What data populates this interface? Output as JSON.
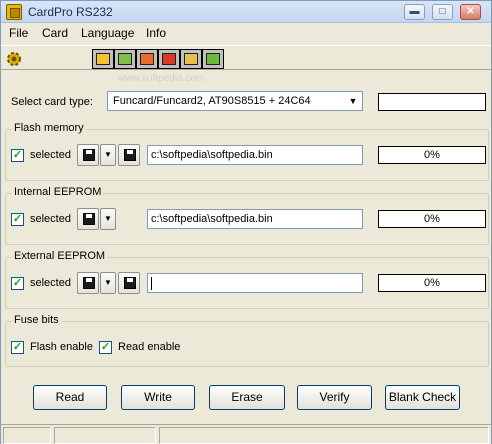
{
  "window": {
    "title": "CardPro RS232"
  },
  "title_buttons": {
    "minimize": "▬",
    "maximize": "□",
    "close": "✕"
  },
  "menu": [
    "File",
    "Card",
    "Language",
    "Info"
  ],
  "toolbar_icons": [
    "settings-icon",
    "card-read-icon",
    "card-write-icon",
    "card-erase-icon",
    "card-verify-icon",
    "card-blank-icon"
  ],
  "watermark": "www.softpedia.com",
  "card_type": {
    "label": "Select card type:",
    "value": "Funcard/Funcard2, AT90S8515 + 24C64",
    "progress": ""
  },
  "flash": {
    "title": "Flash memory",
    "selected_label": "selected",
    "checked": true,
    "path": "c:\\softpedia\\softpedia.bin",
    "progress": "0%"
  },
  "internal": {
    "title": "Internal EEPROM",
    "selected_label": "selected",
    "checked": true,
    "path": "c:\\softpedia\\softpedia.bin",
    "progress": "0%"
  },
  "external": {
    "title": "External EEPROM",
    "selected_label": "selected",
    "checked": true,
    "path": "",
    "progress": "0%"
  },
  "fuse": {
    "title": "Fuse bits",
    "flash_enable": "Flash enable",
    "read_enable": "Read enable"
  },
  "actions": {
    "read": "Read",
    "write": "Write",
    "erase": "Erase",
    "verify": "Verify",
    "blank_check": "Blank Check"
  },
  "checkmark": "✓",
  "dropdown_arrow": "▼",
  "colors": {
    "check": "#21A121",
    "window_bg": "#ECE9D8",
    "title_bg": "#C4D6F0"
  }
}
